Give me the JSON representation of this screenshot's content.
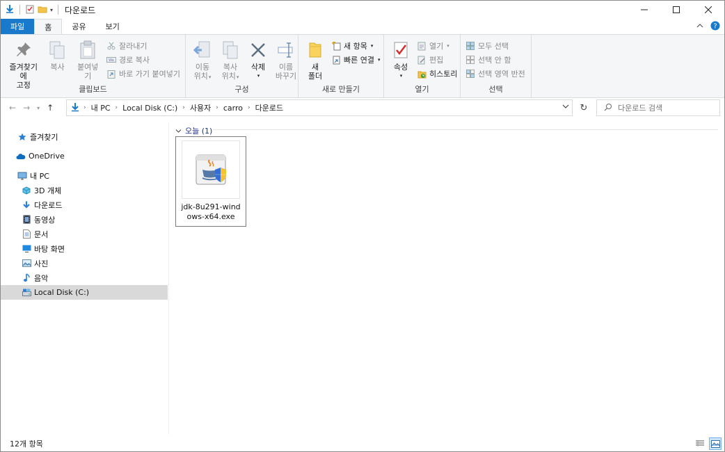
{
  "window": {
    "title": "다운로드"
  },
  "ribbon_tabs": {
    "file": "파일",
    "home": "홈",
    "share": "공유",
    "view": "보기"
  },
  "ribbon": {
    "clipboard": {
      "label": "클립보드",
      "pin": "즐겨찾기에\n고정",
      "pin_line1": "즐겨찾기에",
      "pin_line2": "고정",
      "copy": "복사",
      "paste": "붙여넣기",
      "cut": "잘라내기",
      "copy_path": "경로 복사",
      "paste_shortcut": "바로 가기 붙여넣기"
    },
    "organize": {
      "label": "구성",
      "move_line1": "이동",
      "move_line2": "위치",
      "copy_line1": "복사",
      "copy_line2": "위치",
      "delete": "삭제",
      "rename_line1": "이름",
      "rename_line2": "바꾸기"
    },
    "new": {
      "label": "새로 만들기",
      "folder_line1": "새",
      "folder_line2": "폴더",
      "new_item": "새 항목",
      "easy_access": "빠른 연결"
    },
    "open": {
      "label": "열기",
      "properties": "속성",
      "open": "열기",
      "edit": "편집",
      "history": "히스토리"
    },
    "select": {
      "label": "선택",
      "select_all": "모두 선택",
      "select_none": "선택 안 함",
      "invert": "선택 영역 반전"
    }
  },
  "address": {
    "crumbs": [
      "내 PC",
      "Local Disk (C:)",
      "사용자",
      "carro",
      "다운로드"
    ]
  },
  "search": {
    "placeholder": "다운로드 검색"
  },
  "nav": {
    "favorites": "즐겨찾기",
    "onedrive": "OneDrive",
    "this_pc": "내 PC",
    "objects3d": "3D 개체",
    "downloads": "다운로드",
    "videos": "동영상",
    "documents": "문서",
    "desktop": "바탕 화면",
    "pictures": "사진",
    "music": "음악",
    "local_disk": "Local Disk (C:)"
  },
  "content": {
    "group_header": "오늘 (1)",
    "files": [
      {
        "name": "jdk-8u291-windows-x64.exe"
      }
    ]
  },
  "status": {
    "item_count": "12개 항목"
  },
  "colors": {
    "file_tab": "#1979ca",
    "selection": "#d9d9d9",
    "group_header": "#1e3287"
  }
}
